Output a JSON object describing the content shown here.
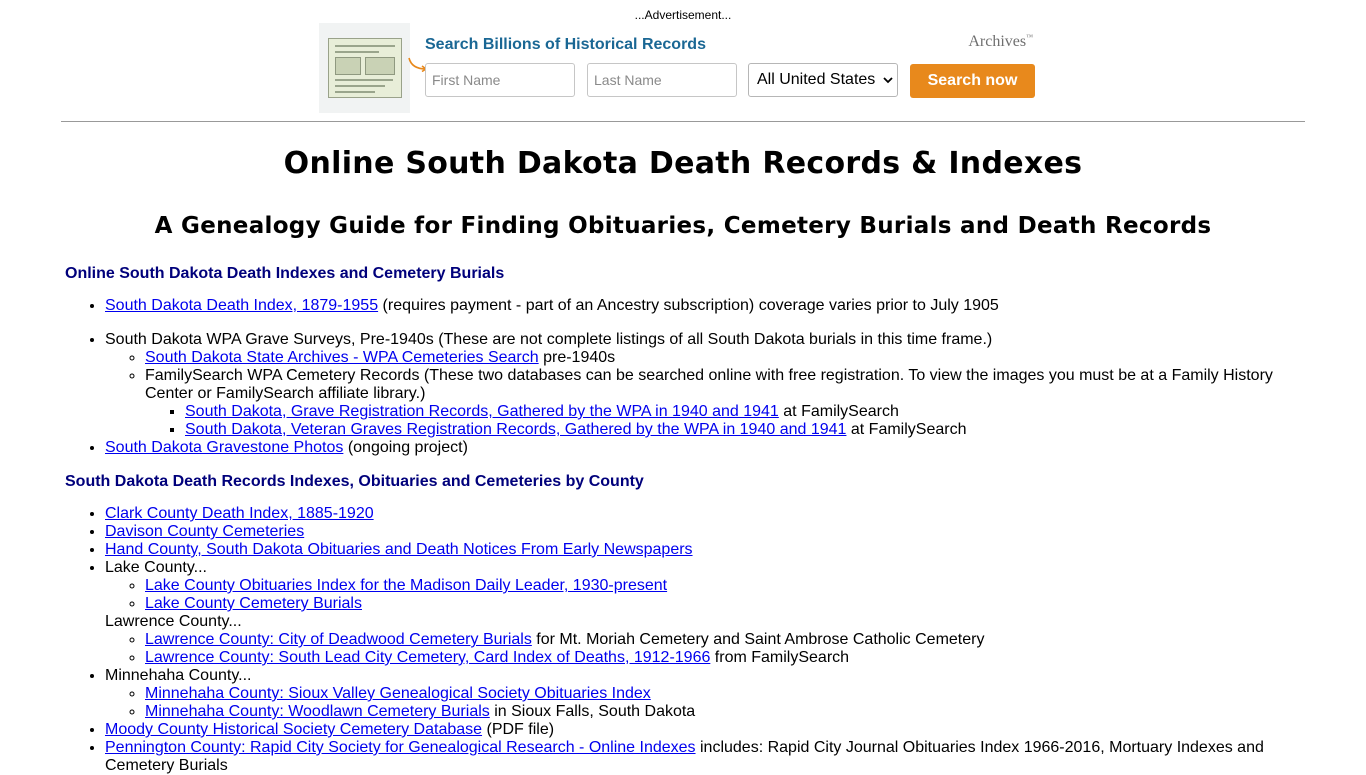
{
  "ad": {
    "label": "...Advertisement...",
    "title": "Search Billions of Historical Records",
    "brand": "Archives",
    "brand_tm": "™",
    "first_name_placeholder": "First Name",
    "last_name_placeholder": "Last Name",
    "location_selected": "All United States",
    "button_label": "Search now",
    "colors": {
      "title": "#1a6794",
      "button": "#e8891c",
      "background": "#f1f3f3"
    }
  },
  "page": {
    "title": "Online South Dakota Death Records & Indexes",
    "subtitle": "A Genealogy Guide for Finding Obituaries, Cemetery Burials and Death Records"
  },
  "section1": {
    "heading": "Online South Dakota Death Indexes and Cemetery Burials",
    "item1": {
      "link": "South Dakota Death Index, 1879-1955",
      "text": " (requires payment - part of an Ancestry subscription) coverage varies prior to July 1905"
    },
    "item2": {
      "text": "South Dakota WPA Grave Surveys, Pre-1940s (These are not complete listings of all South Dakota burials in this time frame.)",
      "sub1": {
        "link": "South Dakota State Archives - WPA Cemeteries Search",
        "text": " pre-1940s"
      },
      "sub2": {
        "text": "FamilySearch WPA Cemetery Records (These two databases can be searched online with free registration. To view the images you must be at a Family History Center or FamilySearch affiliate library.)",
        "subsub1": {
          "link": "South Dakota, Grave Registration Records, Gathered by the WPA in 1940 and 1941",
          "text": " at FamilySearch"
        },
        "subsub2": {
          "link": "South Dakota, Veteran Graves Registration Records, Gathered by the WPA in 1940 and 1941",
          "text": " at FamilySearch"
        }
      }
    },
    "item3": {
      "link": "South Dakota Gravestone Photos",
      "text": " (ongoing project)"
    }
  },
  "section2": {
    "heading": "South Dakota Death Records Indexes, Obituaries and Cemeteries by County",
    "clark": {
      "link": "Clark County Death Index, 1885-1920"
    },
    "davison": {
      "link": "Davison County Cemeteries"
    },
    "hand": {
      "link": "Hand County, South Dakota Obituaries and Death Notices From Early Newspapers"
    },
    "lake": {
      "text": "Lake County...",
      "sub1": {
        "link": "Lake County Obituaries Index for the Madison Daily Leader, 1930-present"
      },
      "sub2": {
        "link": "Lake County Cemetery Burials"
      }
    },
    "lawrence": {
      "text": "Lawrence County...",
      "sub1": {
        "link": "Lawrence County: City of Deadwood Cemetery Burials",
        "text": " for Mt. Moriah Cemetery and Saint Ambrose Catholic Cemetery"
      },
      "sub2": {
        "link": "Lawrence County: South Lead City Cemetery, Card Index of Deaths, 1912-1966",
        "text": " from FamilySearch"
      }
    },
    "minnehaha": {
      "text": "Minnehaha County...",
      "sub1": {
        "link": "Minnehaha County: Sioux Valley Genealogical Society Obituaries Index"
      },
      "sub2": {
        "link": "Minnehaha County: Woodlawn Cemetery Burials",
        "text": " in Sioux Falls, South Dakota"
      }
    },
    "moody": {
      "link": "Moody County Historical Society Cemetery Database",
      "text": " (PDF file)"
    },
    "pennington": {
      "link": "Pennington County: Rapid City Society for Genealogical Research - Online Indexes",
      "text": " includes: Rapid City Journal Obituaries Index 1966-2016, Mortuary Indexes and Cemetery Burials"
    }
  }
}
